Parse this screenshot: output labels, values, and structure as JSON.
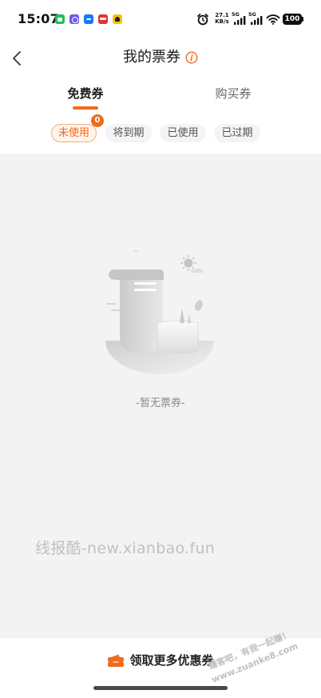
{
  "status_bar": {
    "time": "15:07",
    "notification_icons": [
      "green-message-icon",
      "purple-app-icon",
      "blue-pay-icon",
      "red-app-icon",
      "yellow-app-icon"
    ],
    "alarm_icon": "alarm-clock-icon",
    "net_speed_value": "27.1",
    "net_speed_unit": "KB/s",
    "sim1_type": "5G",
    "sim2_type": "5G",
    "wifi_icon": "wifi-icon",
    "battery_level": "100"
  },
  "header": {
    "back_icon": "back-arrow-icon",
    "title": "我的票券",
    "info_icon": "info-icon"
  },
  "tabs": [
    {
      "label": "免费券",
      "active": true
    },
    {
      "label": "购买券",
      "active": false
    }
  ],
  "filters": [
    {
      "label": "未使用",
      "active": true,
      "badge": "0"
    },
    {
      "label": "将到期",
      "active": false
    },
    {
      "label": "已使用",
      "active": false
    },
    {
      "label": "已过期",
      "active": false
    }
  ],
  "empty_state": {
    "illustration": "empty-ticket-scroll-illustration",
    "message": "-暂无票券-"
  },
  "watermarks": {
    "center_text": "线报酷-new.xianbao.fun",
    "corner_line1": "赚客吧，有我一起赚！",
    "corner_line2": "www.zuanke8.com"
  },
  "bottom_action": {
    "icon": "ticket-icon",
    "label": "领取更多优惠券"
  },
  "colors": {
    "accent": "#ef6b1e",
    "page_bg": "#f3f3f3",
    "text_primary": "#1c1c1c",
    "text_secondary": "#666666"
  }
}
